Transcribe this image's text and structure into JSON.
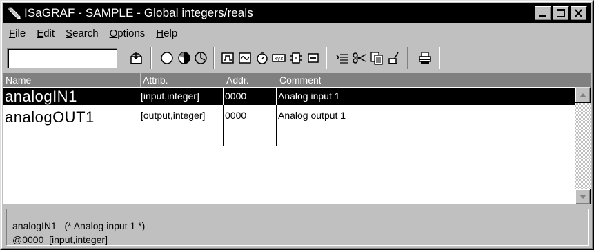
{
  "window": {
    "title": "ISaGRAF - SAMPLE - Global integers/reals",
    "app_icon": "pencil-icon",
    "minimize_icon": "minimize-icon",
    "maximize_icon": "maximize-icon",
    "close_icon": "close-icon"
  },
  "menu": {
    "items": [
      {
        "underline": "F",
        "rest": "ile"
      },
      {
        "underline": "E",
        "rest": "dit"
      },
      {
        "underline": "S",
        "rest": "earch"
      },
      {
        "underline": "O",
        "rest": "ptions"
      },
      {
        "underline": "H",
        "rest": "elp"
      }
    ]
  },
  "toolbar": {
    "search_value": "",
    "icons": [
      "open-file-icon",
      "circle-empty-icon",
      "circle-half-icon",
      "circle-clock-icon",
      "pulse-icon",
      "wave-icon",
      "timer-icon",
      "xyz-icon",
      "block-icon",
      "dash-box-icon",
      "list-insert-icon",
      "scissors-icon",
      "copy-icon",
      "paste-icon",
      "print-icon"
    ]
  },
  "table": {
    "headers": {
      "name": "Name",
      "attrib": "Attrib.",
      "addr": "Addr.",
      "comment": "Comment"
    },
    "rows": [
      {
        "name": "analogIN1",
        "attrib": "[input,integer]",
        "addr": "0000",
        "comment": "Analog input 1",
        "selected": true
      },
      {
        "name": "analogOUT1",
        "attrib": "[output,integer]",
        "addr": "0000",
        "comment": "Analog output 1",
        "selected": false
      }
    ]
  },
  "status": {
    "line1": "analogIN1   (* Analog input 1 *)",
    "line2": "@0000  [input,integer]"
  }
}
